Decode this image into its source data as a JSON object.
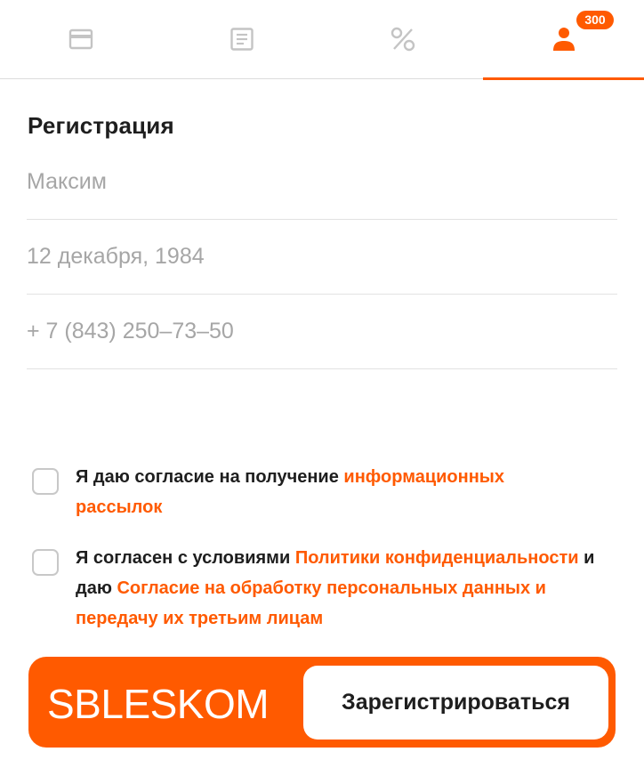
{
  "tabs": [
    {
      "icon": "card-icon",
      "active": false
    },
    {
      "icon": "document-icon",
      "active": false
    },
    {
      "icon": "percent-icon",
      "active": false
    },
    {
      "icon": "user-icon",
      "active": true,
      "badge": "300"
    }
  ],
  "colors": {
    "accent": "#ff5a00",
    "icon_gray": "#c4c4c4",
    "placeholder": "#a6a6a6"
  },
  "form": {
    "title": "Регистрация",
    "name_placeholder": "Максим",
    "birthdate_placeholder": "12 декабря, 1984",
    "phone_placeholder": "+ 7 (843) 250–73–50"
  },
  "consents": {
    "mailing": {
      "text": "Я даю согласие на получение ",
      "link": "информационных рассылок",
      "checked": false
    },
    "privacy": {
      "text1": "Я согласен с условиями ",
      "link1": "Политики конфиденциальности",
      "text2": " и даю ",
      "link2": "Согласие на обработку персональных данных и передачу их третьим лицам",
      "checked": false
    }
  },
  "cta": {
    "brand": "SBLESKOM",
    "button_label": "Зарегистрироваться"
  }
}
